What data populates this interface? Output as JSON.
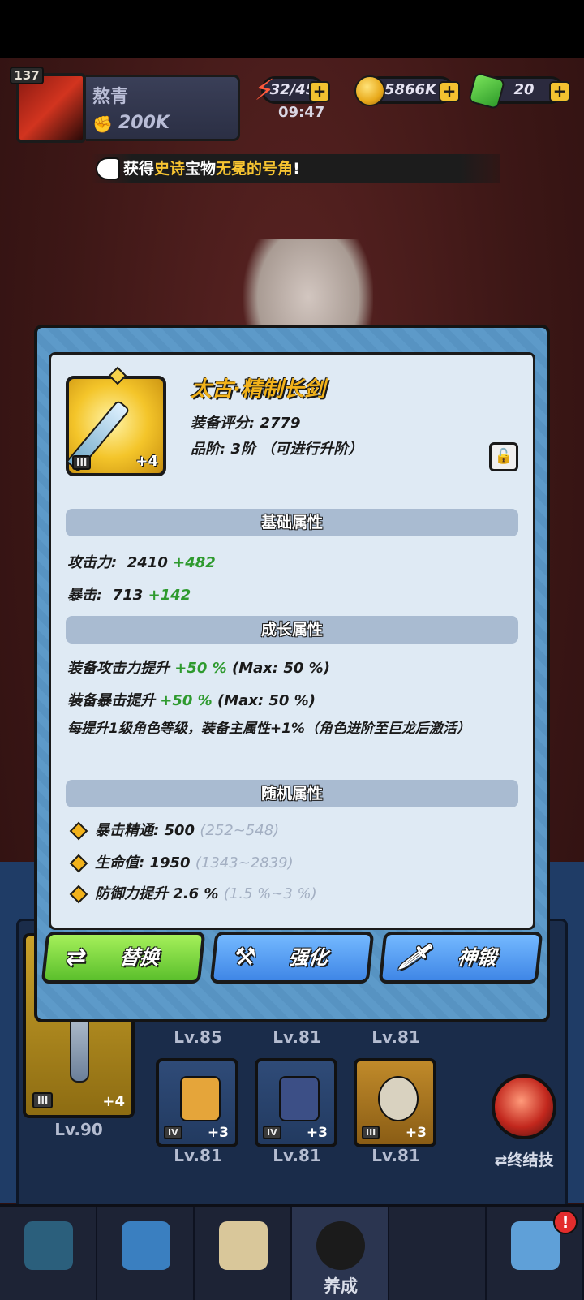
{
  "hud": {
    "player_level": "137",
    "player_name": "熬青",
    "power": "200K",
    "energy": "32/45",
    "energy_timer": "09:47",
    "gold": "5866K",
    "gems": "20",
    "plus_symbol": "+"
  },
  "notice": {
    "prefix": "获得",
    "rarity": "史诗",
    "middle": "宝物",
    "item": "无冕的号角",
    "suffix": "!"
  },
  "item": {
    "name": "太古·精制长剑",
    "score_label": "装备评分:",
    "score": "2779",
    "grade_label": "品阶:",
    "grade_value": "3阶 （可进行升阶）",
    "grade_badge": "III",
    "enhance_level": "+4"
  },
  "sections": {
    "base": "基础属性",
    "growth": "成长属性",
    "random": "随机属性"
  },
  "base_stats": [
    {
      "name": "攻击力:",
      "value": "2410",
      "bonus": "+482"
    },
    {
      "name": "暴击:",
      "value": "713",
      "bonus": "+142"
    }
  ],
  "growth_stats": [
    {
      "name": "装备攻击力提升",
      "value": "+50 %",
      "max": "(Max: 50 %)"
    },
    {
      "name": "装备暴击提升",
      "value": "+50 %",
      "max": "(Max: 50 %)"
    }
  ],
  "growth_note": "每提升1级角色等级，装备主属性+1%（角色进阶至巨龙后激活）",
  "random_stats": [
    {
      "name": "暴击精通:",
      "value": "500",
      "range": "(252~548)"
    },
    {
      "name": "生命值:",
      "value": "1950",
      "range": "(1343~2839)"
    },
    {
      "name": "防御力提升",
      "value": "2.6 %",
      "range": "(1.5 %~3 %)"
    }
  ],
  "actions": {
    "replace": "替换",
    "enhance": "强化",
    "forge": "神锻"
  },
  "equipment": {
    "main_level": "Lv.90",
    "main_grade": "III",
    "main_plus": "+4",
    "row1_levels": [
      "Lv.85",
      "Lv.81",
      "Lv.81"
    ],
    "row2": [
      {
        "grade": "IV",
        "plus": "+3",
        "level": "Lv.81"
      },
      {
        "grade": "IV",
        "plus": "+3",
        "level": "Lv.81"
      },
      {
        "grade": "III",
        "plus": "+3",
        "level": "Lv.81"
      }
    ],
    "ultimate_label": "终结技"
  },
  "nav": {
    "active_label": "养成",
    "badge": "!"
  },
  "colors": {
    "title_gold": "#f2b21a",
    "bonus_green": "#2e9a2e",
    "button_green": "#5bbf2c",
    "button_blue": "#3f86e6"
  }
}
